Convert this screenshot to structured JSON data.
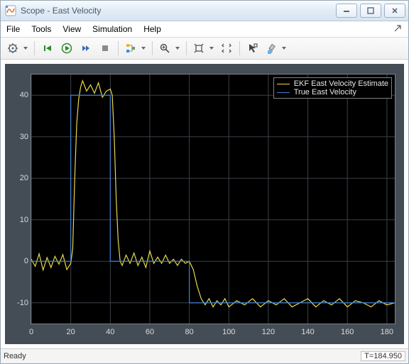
{
  "window": {
    "title": "Scope - East Velocity"
  },
  "menubar": {
    "items": [
      "File",
      "Tools",
      "View",
      "Simulation",
      "Help"
    ]
  },
  "toolbar": {
    "buttons": [
      "settings-icon",
      "step-back-icon",
      "run-icon",
      "step-forward-icon",
      "stop-icon",
      "triggers-icon",
      "zoom-icon",
      "autoscale-icon",
      "restore-axes-icon",
      "cursor-icon",
      "highlight-icon"
    ]
  },
  "status": {
    "ready": "Ready",
    "time": "T=184.950"
  },
  "chart_data": {
    "type": "line",
    "xlabel": "",
    "ylabel": "",
    "xlim": [
      0,
      184
    ],
    "ylim": [
      -15,
      45
    ],
    "xticks": [
      0,
      20,
      40,
      60,
      80,
      100,
      120,
      140,
      160,
      180
    ],
    "yticks": [
      -10,
      0,
      10,
      20,
      30,
      40
    ],
    "legend": {
      "position": "top-right"
    },
    "series": [
      {
        "name": "EKF East Velocity Estimate",
        "color": "#e8d84a",
        "x": [
          0,
          2,
          4,
          6,
          8,
          10,
          12,
          14,
          16,
          18,
          20,
          21,
          22,
          23,
          24,
          25,
          26,
          28,
          30,
          32,
          34,
          36,
          38,
          40,
          41,
          42,
          43,
          44,
          45,
          46,
          48,
          50,
          52,
          54,
          56,
          58,
          60,
          62,
          64,
          66,
          68,
          70,
          72,
          74,
          76,
          78,
          80,
          82,
          84,
          86,
          88,
          90,
          92,
          94,
          96,
          98,
          100,
          104,
          108,
          112,
          116,
          120,
          124,
          128,
          132,
          136,
          140,
          144,
          148,
          152,
          156,
          160,
          164,
          168,
          172,
          176,
          180,
          184
        ],
        "y": [
          0.5,
          -1.2,
          1.8,
          -2.1,
          0.9,
          -1.5,
          1.2,
          -0.7,
          1.6,
          -2.0,
          -0.5,
          3.0,
          20.0,
          33.0,
          39.0,
          42.0,
          43.5,
          41.0,
          42.5,
          40.5,
          43.0,
          39.5,
          41.0,
          41.5,
          40.0,
          30.0,
          15.0,
          5.0,
          0.0,
          -1.0,
          1.5,
          -0.5,
          2.0,
          -1.0,
          1.0,
          -1.5,
          2.5,
          -0.5,
          1.0,
          -0.5,
          1.5,
          -0.5,
          0.5,
          -1.0,
          0.5,
          -0.5,
          0.0,
          -2.0,
          -6.0,
          -9.0,
          -10.5,
          -9.0,
          -11.0,
          -9.5,
          -10.5,
          -9.0,
          -11.0,
          -9.5,
          -10.5,
          -9.0,
          -11.0,
          -9.5,
          -10.5,
          -9.0,
          -11.0,
          -10.0,
          -9.0,
          -11.0,
          -9.5,
          -10.5,
          -9.0,
          -11.0,
          -9.5,
          -10.0,
          -11.0,
          -9.5,
          -10.5,
          -10.0
        ]
      },
      {
        "name": "True East Velocity",
        "color": "#3f7fd1",
        "x": [
          0,
          20,
          20,
          40,
          40,
          80,
          80,
          184
        ],
        "y": [
          0,
          0,
          40,
          40,
          0,
          0,
          -10,
          -10
        ]
      }
    ]
  }
}
